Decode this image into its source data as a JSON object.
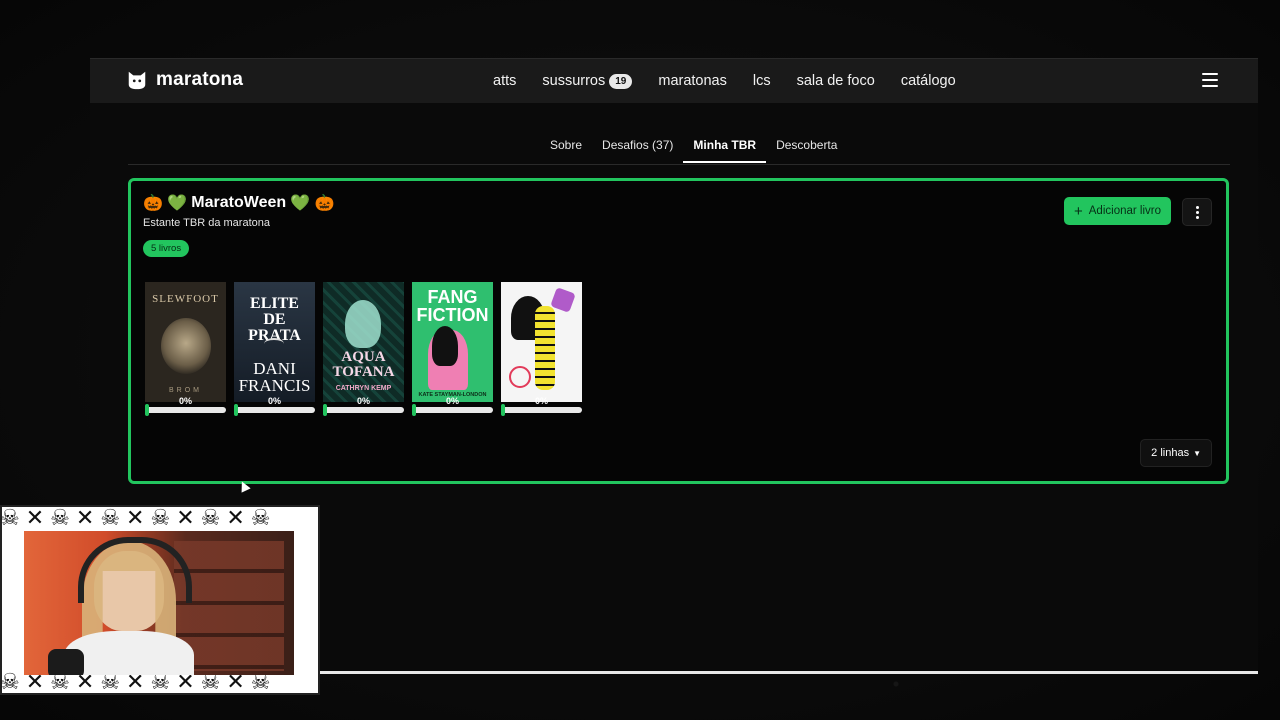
{
  "app": {
    "brand": "maratona",
    "nav": [
      {
        "label": "atts"
      },
      {
        "label": "sussurros",
        "badge": "19"
      },
      {
        "label": "maratonas"
      },
      {
        "label": "lcs"
      },
      {
        "label": "sala de foco"
      },
      {
        "label": "catálogo"
      }
    ]
  },
  "tabs": [
    {
      "label": "Sobre",
      "active": false
    },
    {
      "label": "Desafios (37)",
      "active": false
    },
    {
      "label": "Minha TBR",
      "active": true
    },
    {
      "label": "Descoberta",
      "active": false
    }
  ],
  "shelf": {
    "title_emoji_left": "🎃 💚",
    "title": "MaratoWeen",
    "title_emoji_right": "💚 🎃",
    "subtitle": "Estante TBR da maratona",
    "count": "5 livros",
    "add_button": "Adicionar livro",
    "rows_select": "2 linhas",
    "accent": "#22c55e",
    "books": [
      {
        "cover_text": "SLEWFOOT",
        "cover_author": "BROM",
        "bg": "#2b261f",
        "fg": "#d9c8a8",
        "progress_label": "0%",
        "progress": 0
      },
      {
        "cover_text": "ELITE DE PRATA",
        "cover_author": "DANI FRANCIS",
        "bg": "#1c2733",
        "fg": "#ffffff",
        "progress_label": "0%",
        "progress": 0
      },
      {
        "cover_text": "AQUA TOFANA",
        "cover_author": "CATHRYN KEMP",
        "bg": "#0f2b26",
        "fg": "#d7f5ec",
        "progress_label": "0%",
        "progress": 0
      },
      {
        "cover_text": "FANG FICTION",
        "cover_author": "KATE STAYMAN-LONDON",
        "bg": "#2fbf6f",
        "fg": "#ffffff",
        "progress_label": "0%",
        "progress": 0
      },
      {
        "cover_text": "",
        "cover_author": "",
        "bg": "#f5f5f5",
        "fg": "#111111",
        "progress_label": "0%",
        "progress": 0
      }
    ]
  }
}
